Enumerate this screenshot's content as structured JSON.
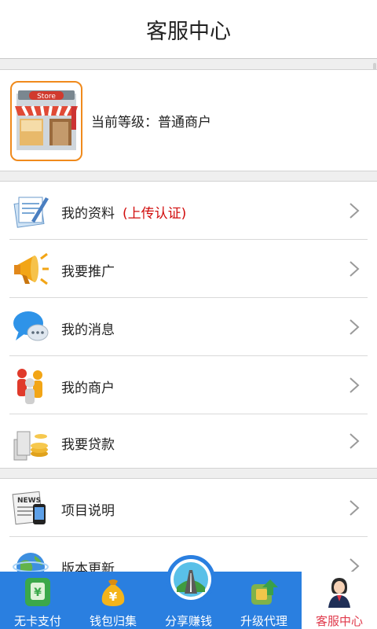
{
  "header": {
    "title": "客服中心"
  },
  "account": {
    "level_text": "当前等级：普通商户",
    "store_icon_text": "Store"
  },
  "menu_group_1": [
    {
      "label": "我的资料",
      "note": "(上传认证)",
      "icon": "documents-icon"
    },
    {
      "label": "我要推广",
      "icon": "megaphone-icon"
    },
    {
      "label": "我的消息",
      "icon": "chat-bubble-icon"
    },
    {
      "label": "我的商户",
      "icon": "people-icon"
    },
    {
      "label": "我要贷款",
      "icon": "coins-icon"
    }
  ],
  "menu_group_2": [
    {
      "label": "项目说明",
      "icon": "news-icon"
    },
    {
      "label": "版本更新",
      "icon": "globe-icon"
    }
  ],
  "tabbar": {
    "active_color": "#e0394b",
    "items": [
      {
        "label": "无卡支付",
        "icon": "card-pay-icon"
      },
      {
        "label": "钱包归集",
        "icon": "money-bag-icon"
      },
      {
        "label": "分享赚钱",
        "icon": "share-icon"
      },
      {
        "label": "升级代理",
        "icon": "upgrade-icon"
      },
      {
        "label": "客服中心",
        "icon": "agent-icon",
        "active": true
      }
    ]
  }
}
